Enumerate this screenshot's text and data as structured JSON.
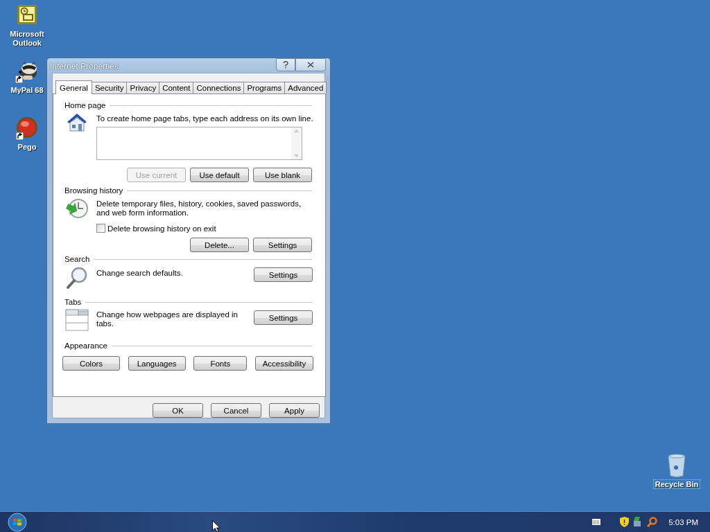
{
  "desktop_icons": [
    {
      "label": "Microsoft Outlook",
      "kind": "outlook",
      "shortcut": false
    },
    {
      "label": "MyPal 68",
      "kind": "raccoon",
      "shortcut": true
    },
    {
      "label": "Pego",
      "kind": "orb",
      "shortcut": true
    }
  ],
  "window": {
    "title": "Internet Properties",
    "tabs": [
      {
        "label": "General",
        "selected": true
      },
      {
        "label": "Security",
        "selected": false
      },
      {
        "label": "Privacy",
        "selected": false
      },
      {
        "label": "Content",
        "selected": false
      },
      {
        "label": "Connections",
        "selected": false
      },
      {
        "label": "Programs",
        "selected": false
      },
      {
        "label": "Advanced",
        "selected": false
      }
    ],
    "sections": [
      {
        "title": "Home page",
        "kind": "home",
        "text": "To create home page tabs, type each address on its own line.",
        "buttons": [
          {
            "label": "Use current",
            "disabled": true
          },
          {
            "label": "Use default",
            "disabled": false
          },
          {
            "label": "Use blank",
            "disabled": false
          }
        ]
      },
      {
        "title": "Browsing history",
        "kind": "history",
        "text": "Delete temporary files, history, cookies, saved passwords, and web form information.",
        "checkbox": {
          "label": "Delete browsing history on exit",
          "checked": false
        },
        "buttons": [
          {
            "label": "Delete...",
            "disabled": false
          },
          {
            "label": "Settings",
            "disabled": false
          }
        ]
      },
      {
        "title": "Search",
        "kind": "search",
        "text": "Change search defaults.",
        "buttons": [
          {
            "label": "Settings",
            "disabled": false
          }
        ]
      },
      {
        "title": "Tabs",
        "kind": "tabs",
        "text": "Change how webpages are displayed in tabs.",
        "buttons": [
          {
            "label": "Settings",
            "disabled": false
          }
        ]
      },
      {
        "title": "Appearance",
        "kind": "appearance",
        "buttons": [
          {
            "label": "Colors",
            "disabled": false
          },
          {
            "label": "Languages",
            "disabled": false
          },
          {
            "label": "Fonts",
            "disabled": false
          },
          {
            "label": "Accessibility",
            "disabled": false
          }
        ]
      }
    ],
    "buttons": [
      {
        "label": "OK",
        "disabled": false
      },
      {
        "label": "Cancel",
        "disabled": false
      },
      {
        "label": "Apply",
        "disabled": false
      }
    ]
  },
  "recycle_bin": {
    "label": "Recycle Bin"
  },
  "taskbar": {
    "clock": "5:03 PM"
  }
}
